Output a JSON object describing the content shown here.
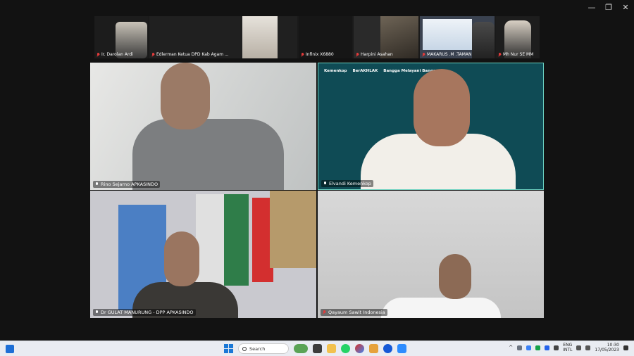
{
  "window_controls": {
    "minimize": "—",
    "restore": "❐",
    "close": "✕"
  },
  "strip": [
    {
      "name": "Ir. Darolan Ardi",
      "muted": true
    },
    {
      "name": "Edlerman Ketua DPD Kab Agam ...",
      "muted": true
    },
    {
      "name": "Infinix X6880",
      "muted": true
    },
    {
      "name": "Harpini Asahan",
      "muted": true
    },
    {
      "name": "MAKARUS .M .TAMAN",
      "muted": true
    },
    {
      "name": "Mh Nur SE MM",
      "muted": true
    }
  ],
  "tiles": [
    {
      "name": "Rino Sejarno APKASINDO",
      "muted": false
    },
    {
      "name": "Elvandi Kemenkop",
      "muted": false
    },
    {
      "name": "Dr GULAT MANURUNG - DPP APKASINDO",
      "muted": false
    },
    {
      "name": "Qayaum Sawit Indonesia",
      "muted": false
    }
  ],
  "tile2_logos": [
    "Kemenkop",
    "BerAKHLAK",
    "Bangga Melayani Bangsa"
  ],
  "taskbar": {
    "search_label": "Search",
    "lang_top": "ENG",
    "lang_bottom": "INTL",
    "time": "10:30",
    "date": "17/05/2023"
  },
  "colors": {
    "accent_border": "#6bd1c0",
    "muted_mic": "#e23b3b"
  }
}
